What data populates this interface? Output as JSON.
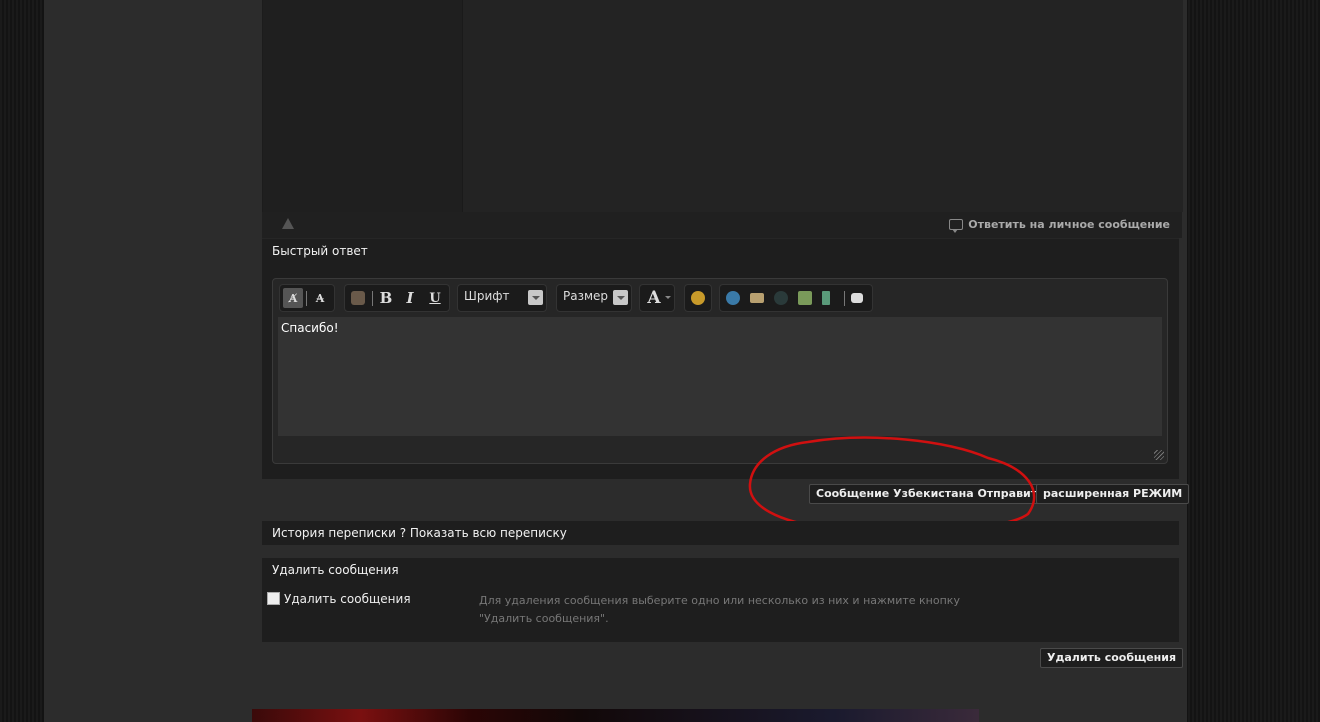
{
  "post": {
    "reply_pm_label": "Ответить на личное сообщение"
  },
  "quick_reply": {
    "title": "Быстрый ответ",
    "font_label": "Шрифт",
    "size_label": "Размер",
    "message_text": "Спасибо!",
    "submit_label": "Сообщение Узбекистана Отправить",
    "advanced_label": "расширенная РЕЖИМ"
  },
  "toolbar": {
    "bold": "B",
    "italic": "I",
    "underline": "U",
    "color": "A"
  },
  "history": {
    "title": "История переписки ? Показать всю переписку"
  },
  "delete": {
    "title": "Удалить сообщения",
    "checkbox_label": "Удалить сообщения",
    "help_text": "Для удаления сообщения выберите одно или несколько из них и нажмите кнопку \"Удалить сообщения\".",
    "button_label": "Удалить сообщения"
  },
  "colors": {
    "annotation": "#d01010",
    "panel": "#1e1e1e",
    "page": "#2c2c2c"
  }
}
